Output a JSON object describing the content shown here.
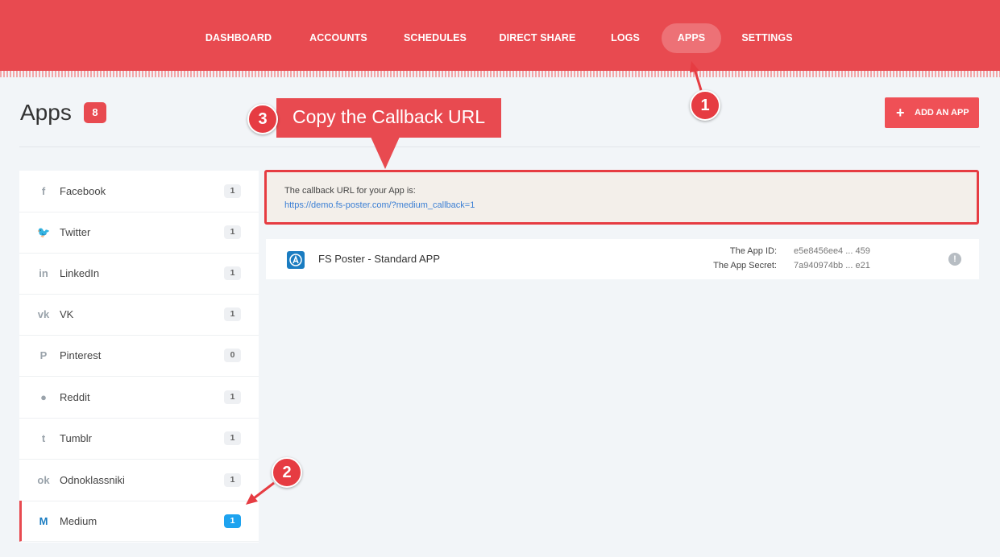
{
  "nav": {
    "items": [
      {
        "label": "DASHBOARD"
      },
      {
        "label": "ACCOUNTS"
      },
      {
        "label": "SCHEDULES"
      },
      {
        "label": "DIRECT SHARE"
      },
      {
        "label": "LOGS"
      },
      {
        "label": "APPS",
        "active": true
      },
      {
        "label": "SETTINGS"
      }
    ]
  },
  "page": {
    "title": "Apps",
    "count": "8",
    "add_button_icon": "+",
    "add_button_label": "ADD AN APP"
  },
  "sidebar": {
    "items": [
      {
        "label": "Facebook",
        "count": "1",
        "icon": "facebook-icon",
        "glyph": "f"
      },
      {
        "label": "Twitter",
        "count": "1",
        "icon": "twitter-icon",
        "glyph": "🐦"
      },
      {
        "label": "LinkedIn",
        "count": "1",
        "icon": "linkedin-icon",
        "glyph": "in"
      },
      {
        "label": "VK",
        "count": "1",
        "icon": "vk-icon",
        "glyph": "vk"
      },
      {
        "label": "Pinterest",
        "count": "0",
        "icon": "pinterest-icon",
        "glyph": "P"
      },
      {
        "label": "Reddit",
        "count": "1",
        "icon": "reddit-icon",
        "glyph": "●"
      },
      {
        "label": "Tumblr",
        "count": "1",
        "icon": "tumblr-icon",
        "glyph": "t"
      },
      {
        "label": "Odnoklassniki",
        "count": "1",
        "icon": "odnoklassniki-icon",
        "glyph": "ok"
      },
      {
        "label": "Medium",
        "count": "1",
        "icon": "medium-icon",
        "glyph": "M",
        "active": true
      }
    ]
  },
  "annotations": {
    "step1": "1",
    "step2": "2",
    "step3": "3",
    "callout_text": "Copy the Callback URL"
  },
  "callback": {
    "label": "The callback URL for your App is:",
    "url": "https://demo.fs-poster.com/?medium_callback=1"
  },
  "app": {
    "name": "FS Poster - Standard APP",
    "app_id_label": "The App ID:",
    "app_id_value": "e5e8456ee4 ... 459",
    "app_secret_label": "The App Secret:",
    "app_secret_value": "7a940974bb ... e21",
    "info_glyph": "!"
  },
  "colors": {
    "brand": "#e84a50",
    "active_badge": "#1ea3ef",
    "link": "#3b7fd4"
  }
}
